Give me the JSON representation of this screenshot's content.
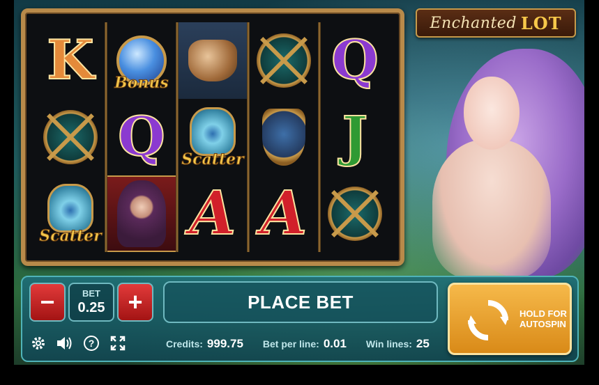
{
  "logo": {
    "word1": "Enchanted",
    "word2": "LOT"
  },
  "reels": [
    [
      {
        "sym": "K"
      },
      {
        "sym": "compass"
      },
      {
        "sym": "scatter",
        "label": "Scatter"
      }
    ],
    [
      {
        "sym": "bonus",
        "label": "Bonus"
      },
      {
        "sym": "Q"
      },
      {
        "sym": "witch"
      }
    ],
    [
      {
        "sym": "pot"
      },
      {
        "sym": "scatter",
        "label": "Scatter"
      },
      {
        "sym": "A"
      }
    ],
    [
      {
        "sym": "compass"
      },
      {
        "sym": "shield"
      },
      {
        "sym": "A"
      }
    ],
    [
      {
        "sym": "Q"
      },
      {
        "sym": "J"
      },
      {
        "sym": "compass"
      }
    ]
  ],
  "controls": {
    "minus_label": "−",
    "plus_label": "+",
    "bet_label": "BET",
    "bet_value": "0.25",
    "place_bet_label": "PLACE BET",
    "autospin_label": "HOLD FOR AUTOSPIN",
    "credits_label": "Credits:",
    "credits_value": "999.75",
    "bet_per_line_label": "Bet per line:",
    "bet_per_line_value": "0.01",
    "win_lines_label": "Win lines:",
    "win_lines_value": "25"
  },
  "icons": [
    "gear-icon",
    "speaker-icon",
    "help-icon",
    "fullscreen-icon"
  ],
  "colors": {
    "accent_teal": "#4fb3b8",
    "autospin_orange": "#f6b94a",
    "bet_red": "#e23a3a"
  }
}
